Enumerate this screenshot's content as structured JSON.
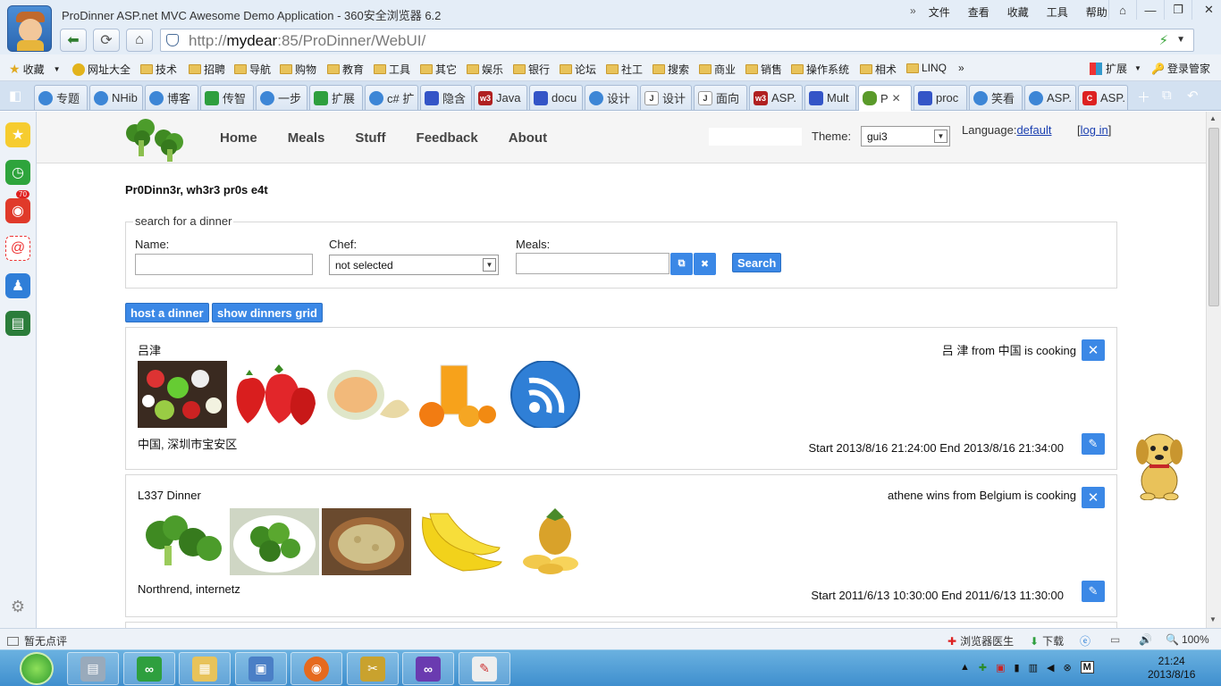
{
  "window": {
    "title": "ProDinner ASP.net MVC Awesome Demo Application - 360安全浏览器 6.2",
    "menu": [
      "文件",
      "查看",
      "收藏",
      "工具",
      "帮助"
    ],
    "more_glyph": "»",
    "controls": {
      "pin": "⌂",
      "minimize": "—",
      "maximize": "❐",
      "close": "✕"
    }
  },
  "address": {
    "prefix": "http://",
    "host": "mydear",
    "rest": ":85/ProDinner/WebUI/"
  },
  "bookmarks": {
    "favorites_label": "收藏",
    "items": [
      "网址大全",
      "技术",
      "招聘",
      "导航",
      "购物",
      "教育",
      "工具",
      "其它",
      "娱乐",
      "银行",
      "论坛",
      "社工",
      "搜索",
      "商业",
      "销售",
      "操作系统",
      "相术",
      "LINQ"
    ],
    "more": "»",
    "extend_label": "扩展",
    "login_label": "登录管家"
  },
  "tabs": [
    {
      "label": "专题",
      "icon": "ie"
    },
    {
      "label": "NHib",
      "icon": "ie"
    },
    {
      "label": "博客",
      "icon": "ie"
    },
    {
      "label": "传智",
      "icon": "green"
    },
    {
      "label": "一步",
      "icon": "ie"
    },
    {
      "label": "扩展",
      "icon": "green"
    },
    {
      "label": "c# 扩",
      "icon": "ie"
    },
    {
      "label": "隐含",
      "icon": "paw"
    },
    {
      "label": "Java",
      "icon": "w3"
    },
    {
      "label": "docu",
      "icon": "paw"
    },
    {
      "label": "设计",
      "icon": "ie"
    },
    {
      "label": "设计",
      "icon": "j"
    },
    {
      "label": "面向",
      "icon": "j"
    },
    {
      "label": "ASP.",
      "icon": "w3"
    },
    {
      "label": "Mult",
      "icon": "paw"
    },
    {
      "label": "P",
      "icon": "broc",
      "active": true
    },
    {
      "label": "proc",
      "icon": "paw"
    },
    {
      "label": "笑看",
      "icon": "ie"
    },
    {
      "label": "ASP.",
      "icon": "ie"
    },
    {
      "label": "ASP.",
      "icon": "red"
    }
  ],
  "sidebar": {
    "weibo_badge": "70"
  },
  "site": {
    "nav": [
      "Home",
      "Meals",
      "Stuff",
      "Feedback",
      "About"
    ],
    "theme_label": "Theme:",
    "theme_value": "gui3",
    "language_label": "Language:",
    "language_value": "default",
    "login_open": "[",
    "login_label": "log in",
    "login_close": "]",
    "tagline": "Pr0Dinn3r, wh3r3 pr0s e4t"
  },
  "search": {
    "legend": "search for a dinner",
    "name_label": "Name:",
    "name_value": "",
    "chef_label": "Chef:",
    "chef_value": "not selected",
    "meals_label": "Meals:",
    "meals_value": "",
    "search_button": "Search"
  },
  "actions": {
    "host": "host a dinner",
    "grid": "show dinners grid"
  },
  "dinners": [
    {
      "title": "吕津",
      "cook": "吕 津 from 中国 is cooking",
      "place": "中国, 深圳市宝安区",
      "time": "Start 2013/8/16 21:24:00 End 2013/8/16 21:34:00",
      "meals": [
        "salad",
        "strawberries",
        "melon",
        "orange-juice",
        "rss"
      ]
    },
    {
      "title": "L337 Dinner",
      "cook": "athene wins from Belgium is cooking",
      "place": "Northrend, internetz",
      "time": "Start 2011/6/13 10:30:00 End 2011/6/13 11:30:00",
      "meals": [
        "broccoli",
        "broccoli-bowl",
        "soup",
        "bananas",
        "pineapple"
      ]
    }
  ],
  "status": {
    "left": "暂无点评",
    "doctor": "浏览器医生",
    "download": "下载",
    "zoom": "100%"
  },
  "taskbar": {
    "apps": [
      "vs2012",
      "explorer",
      "pc",
      "firefox",
      "tools",
      "vs",
      "paint"
    ],
    "tray_ime": "M",
    "time": "21:24",
    "date": "2013/8/16"
  }
}
